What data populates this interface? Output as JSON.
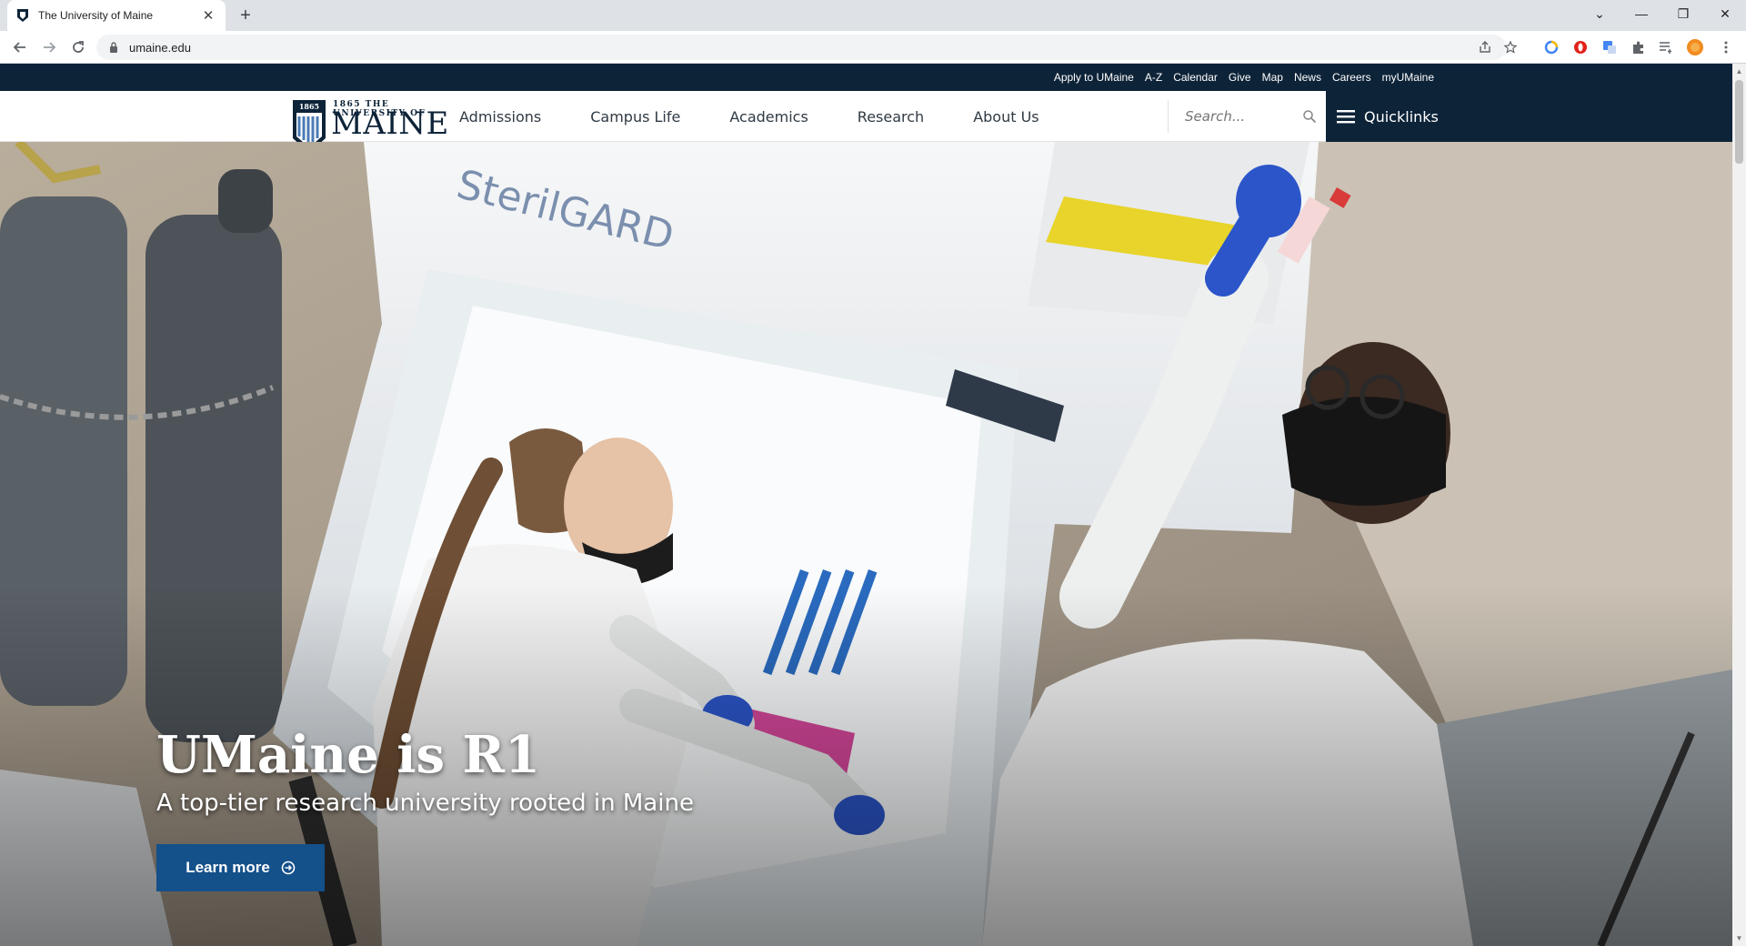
{
  "browser": {
    "tab_title": "The University of Maine",
    "tab_close": "✕",
    "new_tab": "+",
    "url": "umaine.edu",
    "win_minimize": "—",
    "win_restore": "❐",
    "win_close": "✕",
    "tab_list": "⌄"
  },
  "utility_nav": {
    "links": [
      "Apply to UMaine",
      "A-Z",
      "Calendar",
      "Give",
      "Map",
      "News",
      "Careers",
      "myUMaine"
    ]
  },
  "logo": {
    "small_text": "1865 THE UNIVERSITY OF",
    "big_text": "MAINE"
  },
  "main_nav": {
    "items": [
      "Admissions",
      "Campus Life",
      "Academics",
      "Research",
      "About Us"
    ],
    "search_placeholder": "Search...",
    "quicklinks_label": "Quicklinks"
  },
  "hero": {
    "title": "UMaine is R1",
    "subtitle": "A top-tier research university rooted in Maine",
    "button_label": "Learn more"
  },
  "colors": {
    "navy": "#0d2338",
    "button_blue": "#14508a"
  }
}
